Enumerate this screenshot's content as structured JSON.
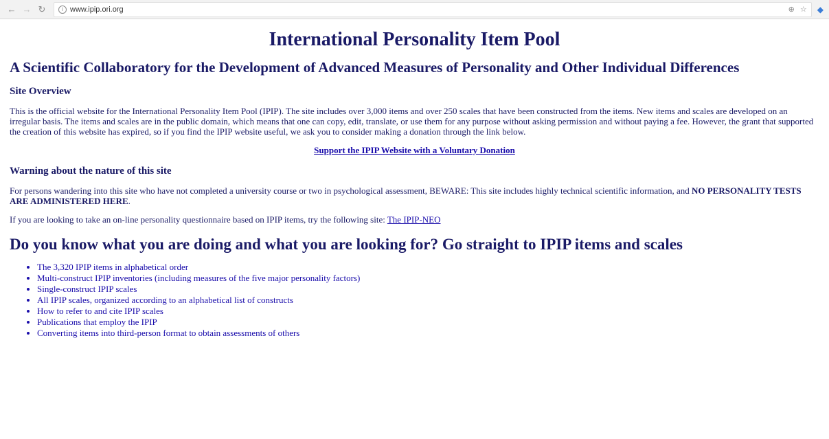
{
  "browser": {
    "url": "www.ipip.ori.org"
  },
  "header": {
    "title": "International Personality Item Pool",
    "subtitle": "A Scientific Collaboratory for the Development of Advanced Measures of Personality and Other Individual Differences"
  },
  "overview": {
    "heading": "Site Overview",
    "text": "This is the official website for the International Personality Item Pool (IPIP). The site includes over 3,000 items and over 250 scales that have been constructed from the items. New items and scales are developed on an irregular basis. The items and scales are in the public domain, which means that one can copy, edit, translate, or use them for any purpose without asking permission and without paying a fee. However, the grant that supported the creation of this website has expired, so if you find the IPIP website useful, we ask you to consider making a donation through the link below.",
    "donation_link": "Support the IPIP Website with a Voluntary Donation"
  },
  "warning": {
    "heading": "Warning about the nature of this site",
    "text_before": "For persons wandering into this site who have not completed a university course or two in psychological assessment, BEWARE: This site includes highly technical scientific information, and ",
    "text_bold": "NO PERSONALITY TESTS ARE ADMINISTERED HERE",
    "text_after": ".",
    "neo_text": "If you are looking to take an on-line personality questionnaire based on IPIP items, try the following site: ",
    "neo_link": "The IPIP-NEO"
  },
  "straight": {
    "heading": "Do you know what you are doing and what you are looking for? Go straight to IPIP items and scales",
    "items": [
      "The 3,320 IPIP items in alphabetical order",
      "Multi-construct IPIP inventories (including measures of the five major personality factors)",
      "Single-construct IPIP scales",
      "All IPIP scales, organized according to an alphabetical list of constructs",
      "How to refer to and cite IPIP scales",
      "Publications that employ the IPIP",
      "Converting items into third-person format to obtain assessments of others"
    ]
  }
}
